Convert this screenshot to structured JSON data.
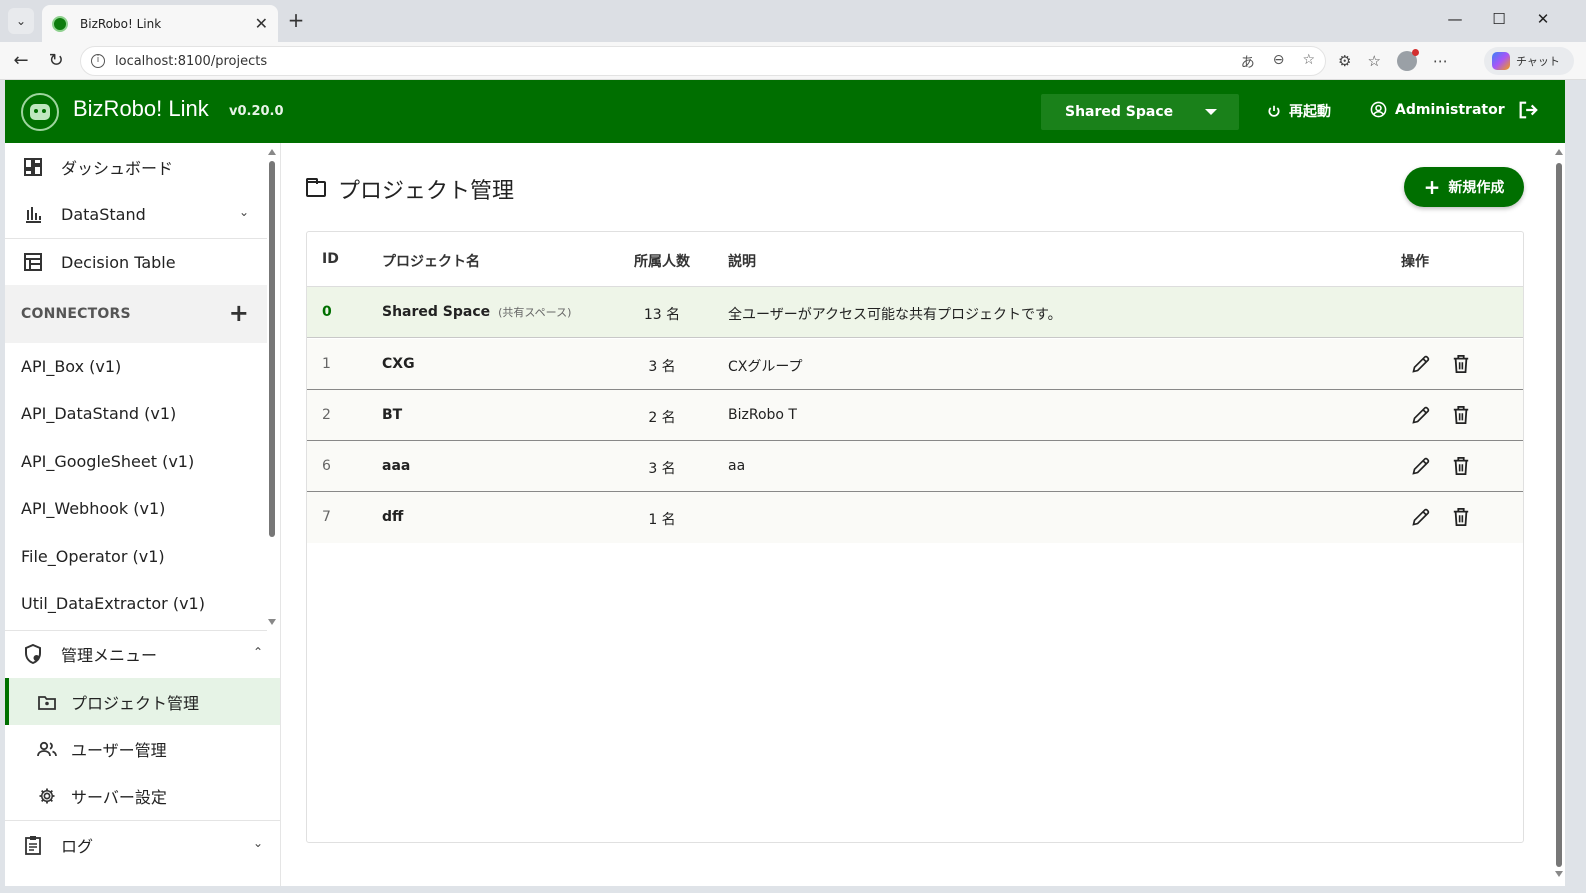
{
  "browser": {
    "tab_title": "BizRobo! Link",
    "url": "localhost:8100/projects",
    "chat_label": "チャット",
    "translate_glyph": "あ"
  },
  "app": {
    "title": "BizRobo! Link",
    "version": "v0.20.0",
    "space": "Shared Space",
    "restart": "再起動",
    "user": "Administrator",
    "brand_color": "#006f00"
  },
  "sidebar": {
    "dashboard": "ダッシュボード",
    "datastand": "DataStand",
    "decision_table": "Decision Table",
    "connectors_header": "CONNECTORS",
    "connectors": [
      "API_Box (v1)",
      "API_DataStand (v1)",
      "API_GoogleSheet (v1)",
      "API_Webhook (v1)",
      "File_Operator (v1)",
      "Util_DataExtractor (v1)"
    ],
    "admin_menu": "管理メニュー",
    "admin_items": [
      "プロジェクト管理",
      "ユーザー管理",
      "サーバー設定"
    ],
    "log": "ログ"
  },
  "main": {
    "title": "プロジェクト管理",
    "new_button": "新規作成",
    "columns": {
      "id": "ID",
      "name": "プロジェクト名",
      "members": "所属人数",
      "description": "説明",
      "actions": "操作"
    },
    "rows": [
      {
        "id": "0",
        "name": "Shared Space",
        "sub": "(共有スペース)",
        "members": "13 名",
        "description": "全ユーザーがアクセス可能な共有プロジェクトです。"
      },
      {
        "id": "1",
        "name": "CXG",
        "sub": "",
        "members": "3 名",
        "description": "CXグループ"
      },
      {
        "id": "2",
        "name": "BT",
        "sub": "",
        "members": "2 名",
        "description": "BizRobo T"
      },
      {
        "id": "6",
        "name": "aaa",
        "sub": "",
        "members": "3 名",
        "description": "aa"
      },
      {
        "id": "7",
        "name": "dff",
        "sub": "",
        "members": "1 名",
        "description": ""
      }
    ]
  }
}
